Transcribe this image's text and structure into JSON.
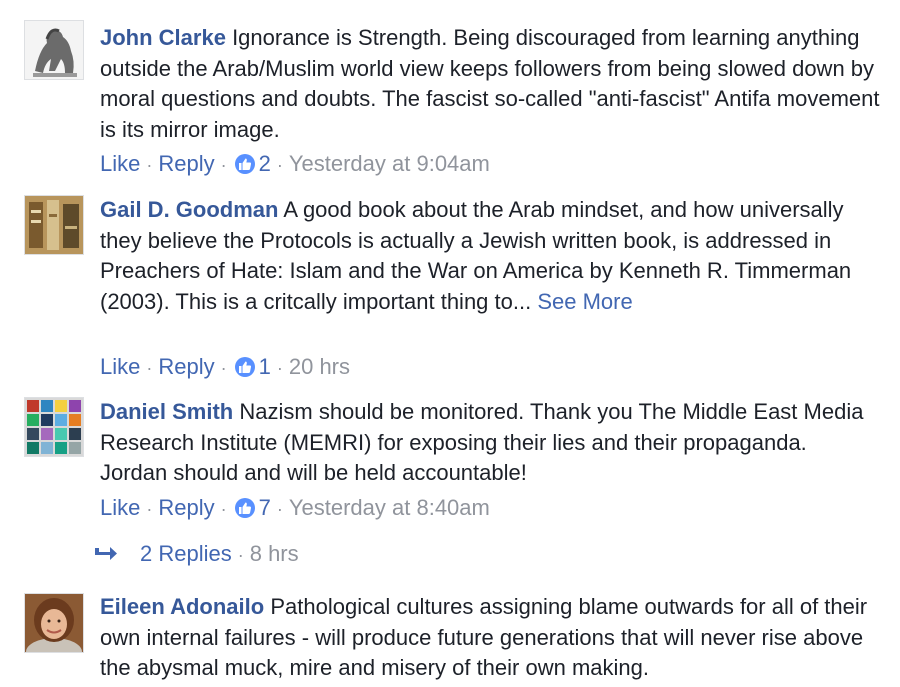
{
  "comments": [
    {
      "author": "John Clarke",
      "text": "Ignorance is Strength. Being discouraged from learning anything outside the Arab/Muslim world view keeps followers from being slowed down by moral questions and doubts. The fascist so-called \"anti-fascist\" Antifa movement is its mirror image.",
      "see_more": "",
      "like_label": "Like",
      "reply_label": "Reply",
      "reactions": "2",
      "time": "Yesterday at 9:04am"
    },
    {
      "author": "Gail D. Goodman",
      "text": "A good book about the Arab mindset, and how universally they believe the Protocols is actually a Jewish written book, is addressed in Preachers of Hate: Islam and the War on America by Kenneth R. Timmerman (2003). This is a critcally important thing to...",
      "see_more": "See More",
      "like_label": "Like",
      "reply_label": "Reply",
      "reactions": "1",
      "time": "20 hrs"
    },
    {
      "author": "Daniel Smith",
      "text": "Nazism should be monitored. Thank you The Middle East Media Research Institute (MEMRI) for exposing their lies and their propaganda. Jordan should and will be held accountable!",
      "see_more": "",
      "like_label": "Like",
      "reply_label": "Reply",
      "reactions": "7",
      "time": "Yesterday at 8:40am",
      "replies_label": "2 Replies",
      "replies_time": "8 hrs"
    },
    {
      "author": "Eileen Adonailo",
      "text": "Pathological cultures assigning blame outwards for all of their own internal failures - will produce future generations that will never rise above the abysmal muck, mire and misery of their own making.",
      "see_more": ""
    }
  ],
  "colors": {
    "author": "#365899",
    "link": "#4267b2",
    "meta": "#90949c",
    "like_badge": "#5890ff"
  },
  "icons": [
    "like-thumb-icon",
    "reply-arrow-icon"
  ]
}
